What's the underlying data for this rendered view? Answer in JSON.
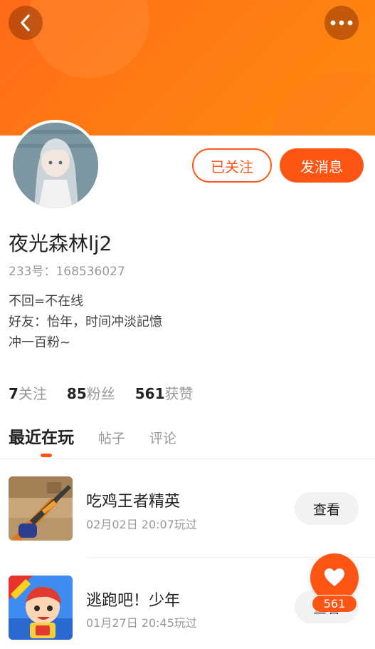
{
  "colors": {
    "accent": "#ff5514",
    "header_gradient_start": "#ff6a1a",
    "header_gradient_end": "#ff8a10"
  },
  "header": {
    "back_icon": "chevron-left-icon",
    "more_icon": "more-horizontal-icon"
  },
  "profile": {
    "username": "夜光森林lj2",
    "uid": "233号：168536027",
    "bio": [
      "不回=不在线",
      "好友：怡年，时间冲淡記憶",
      "冲一百粉~"
    ],
    "follow_button": "已关注",
    "message_button": "发消息"
  },
  "stats": [
    {
      "count": "7",
      "label": "关注"
    },
    {
      "count": "85",
      "label": "粉丝"
    },
    {
      "count": "561",
      "label": "获赞"
    }
  ],
  "tabs": [
    "最近在玩",
    "帖子",
    "评论"
  ],
  "games": [
    {
      "title": "吃鸡王者精英",
      "time": "02月02日 20:07玩过",
      "button": "查看"
    },
    {
      "title": "逃跑吧！少年",
      "time": "01月27日 20:45玩过",
      "button": "查看"
    }
  ],
  "like": {
    "icon": "heart-icon",
    "count": "561"
  }
}
